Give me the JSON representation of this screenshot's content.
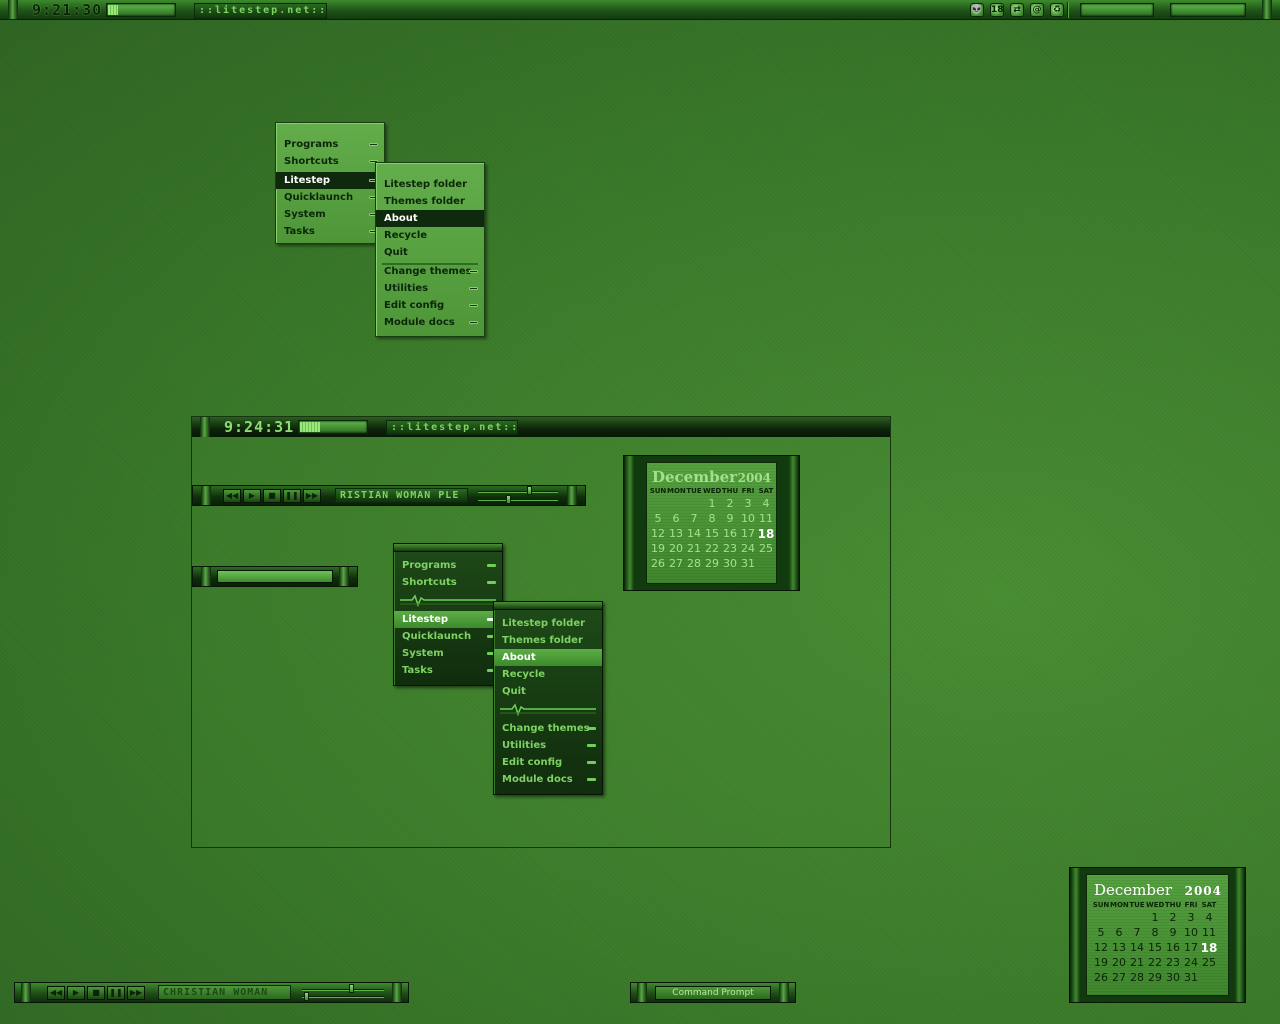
{
  "topbar": {
    "time": "9:21:30",
    "meter_level": 0.15,
    "site_label": "::litestep.net::...",
    "tray": [
      {
        "icon": "alien-icon",
        "text": "👽"
      },
      {
        "icon": "calendar-date-icon",
        "text": "18"
      },
      {
        "icon": "network-icon",
        "text": "⇄"
      },
      {
        "icon": "swirl-icon",
        "text": "@"
      },
      {
        "icon": "recycle-icon",
        "text": "♻"
      }
    ]
  },
  "menu_main": {
    "items": [
      {
        "label": "Programs",
        "submenu": true
      },
      {
        "label": "Shortcuts",
        "submenu": true
      },
      {
        "label": "Litestep",
        "submenu": true,
        "selected": true
      },
      {
        "label": "Quicklaunch",
        "submenu": true
      },
      {
        "label": "System",
        "submenu": true
      },
      {
        "label": "Tasks",
        "submenu": true
      }
    ]
  },
  "menu_litestep": {
    "items": [
      {
        "label": "Litestep folder",
        "submenu": false
      },
      {
        "label": "Themes folder",
        "submenu": false
      },
      {
        "label": "About",
        "submenu": false,
        "selected": true
      },
      {
        "label": "Recycle",
        "submenu": false
      },
      {
        "label": "Quit",
        "submenu": false
      },
      {
        "label": "Change themes",
        "submenu": true
      },
      {
        "label": "Utilities",
        "submenu": true
      },
      {
        "label": "Edit config",
        "submenu": true
      },
      {
        "label": "Module docs",
        "submenu": true
      }
    ]
  },
  "preview": {
    "time": "9:24:31",
    "meter_level": 0.3,
    "site_label": "::litestep.net::...",
    "player_track": "RISTIAN WOMAN  PLE",
    "buttons": [
      {
        "icon": "rewind-icon",
        "text": "◀◀"
      },
      {
        "icon": "play-icon",
        "text": "▶"
      },
      {
        "icon": "stop-icon",
        "text": "■"
      },
      {
        "icon": "pause-icon",
        "text": "❚❚"
      },
      {
        "icon": "forward-icon",
        "text": "▶▶"
      }
    ]
  },
  "preview_menu_main": {
    "items": [
      {
        "label": "Programs",
        "submenu": true
      },
      {
        "label": "Shortcuts",
        "submenu": true
      },
      {
        "label": "Litestep",
        "submenu": true,
        "selected": true
      },
      {
        "label": "Quicklaunch",
        "submenu": true
      },
      {
        "label": "System",
        "submenu": true
      },
      {
        "label": "Tasks",
        "submenu": true
      }
    ]
  },
  "preview_menu_litestep": {
    "items": [
      {
        "label": "Litestep folder",
        "submenu": false
      },
      {
        "label": "Themes folder",
        "submenu": false
      },
      {
        "label": "About",
        "submenu": false,
        "selected": true
      },
      {
        "label": "Recycle",
        "submenu": false
      },
      {
        "label": "Quit",
        "submenu": false
      },
      {
        "label": "Change themes",
        "submenu": true
      },
      {
        "label": "Utilities",
        "submenu": true
      },
      {
        "label": "Edit config",
        "submenu": true
      },
      {
        "label": "Module docs",
        "submenu": true
      }
    ]
  },
  "calendar": {
    "month": "December",
    "year": "2004",
    "weekdays": [
      "SUN",
      "MON",
      "TUE",
      "WED",
      "THU",
      "FRI",
      "SAT"
    ],
    "first_weekday": 3,
    "days_in_month": 31,
    "today": 18
  },
  "bottombar": {
    "track": "CHRISTIAN WOMAN",
    "buttons": [
      {
        "icon": "rewind-icon",
        "text": "◀◀"
      },
      {
        "icon": "play-icon",
        "text": "▶"
      },
      {
        "icon": "stop-icon",
        "text": "■"
      },
      {
        "icon": "pause-icon",
        "text": "❚❚"
      },
      {
        "icon": "forward-icon",
        "text": "▶▶"
      }
    ],
    "command_prompt": "Command Prompt"
  },
  "colors": {
    "desktop": "#3f7f2c",
    "accent": "#7ed263",
    "dark": "#0f290c"
  }
}
